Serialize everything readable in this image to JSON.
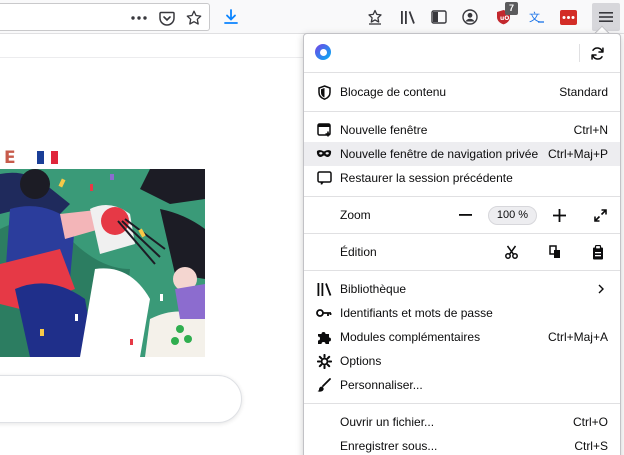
{
  "toolbar": {
    "page_actions_icon": "more-horizontal-icon",
    "pocket_icon": "pocket-icon",
    "bookmark_icon": "star-icon",
    "downloads_icon": "download-arrow-icon",
    "extensions": [
      {
        "name": "reading-list-star-icon"
      },
      {
        "name": "library-icon"
      },
      {
        "name": "sidebar-icon"
      },
      {
        "name": "account-icon"
      },
      {
        "name": "ublock-origin-icon",
        "badge": "7"
      },
      {
        "name": "translate-icon"
      },
      {
        "name": "lastpass-icon"
      }
    ],
    "menu_icon": "hamburger-menu-icon"
  },
  "page": {
    "doodle_letter": "E",
    "flag_colors": [
      "#1a3e97",
      "#ffffff",
      "#e0263b"
    ]
  },
  "menu": {
    "content_blocking": {
      "label": "Blocage de contenu",
      "value": "Standard"
    },
    "new_window": {
      "label": "Nouvelle fenêtre",
      "shortcut": "Ctrl+N"
    },
    "private_window": {
      "label": "Nouvelle fenêtre de navigation privée",
      "shortcut": "Ctrl+Maj+P"
    },
    "restore_session": {
      "label": "Restaurer la session précédente"
    },
    "zoom": {
      "label": "Zoom",
      "minus": "−",
      "value": "100 %",
      "plus": "+"
    },
    "edit": {
      "label": "Édition"
    },
    "library": {
      "label": "Bibliothèque"
    },
    "logins": {
      "label": "Identifiants et mots de passe"
    },
    "addons": {
      "label": "Modules complémentaires",
      "shortcut": "Ctrl+Maj+A"
    },
    "options": {
      "label": "Options"
    },
    "customize": {
      "label": "Personnaliser..."
    },
    "open_file": {
      "label": "Ouvrir un fichier...",
      "shortcut": "Ctrl+O"
    },
    "save_as": {
      "label": "Enregistrer sous...",
      "shortcut": "Ctrl+S"
    }
  },
  "colors": {
    "accent_blue": "#0a84ff",
    "ublock_red": "#c3282e",
    "lastpass_red": "#d32d27",
    "hover_bg": "#ededf0"
  }
}
